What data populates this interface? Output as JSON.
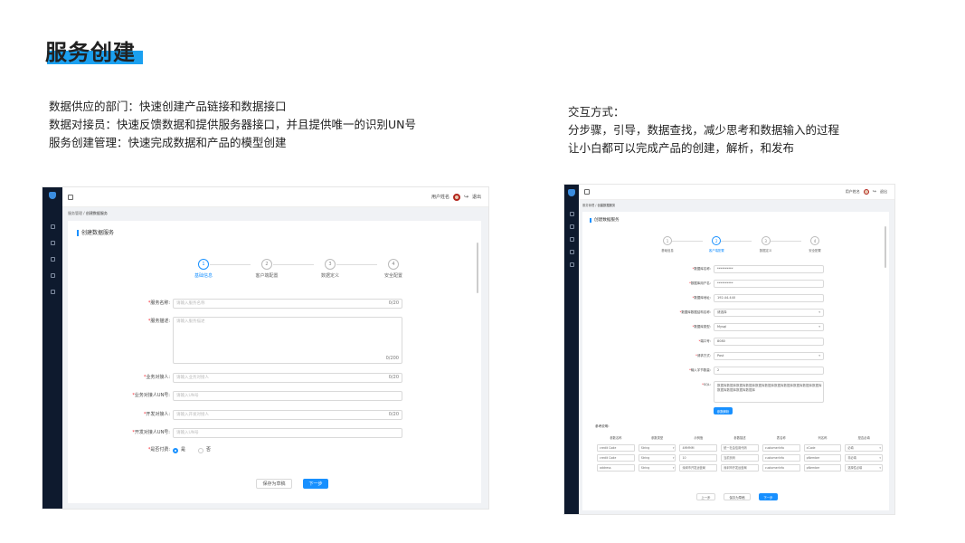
{
  "slide": {
    "title": "服务创建",
    "left_lines": [
      "数据供应的部门：快速创建产品链接和数据接口",
      "数据对接员：快速反馈数据和提供服务器接口，并且提供唯一的识别UN号",
      "服务创建管理：快速完成数据和产品的模型创建"
    ],
    "right_lines": [
      "交互方式：",
      "分步骤，引导，数据查找，减少思考和数据输入的过程",
      "让小白都可以完成产品的创建，解析，和发布"
    ]
  },
  "screen1": {
    "header": {
      "user_name": "用户姓名",
      "logout": "退出"
    },
    "breadcrumb": {
      "parent": "服务管理",
      "sep": "/",
      "current": "创建数据服务"
    },
    "card_title": "创建数据服务",
    "steps": [
      {
        "num": "1",
        "label": "基础信息"
      },
      {
        "num": "2",
        "label": "客户端配置"
      },
      {
        "num": "3",
        "label": "数据定义"
      },
      {
        "num": "4",
        "label": "安全配置"
      }
    ],
    "fields": [
      {
        "label": "服务名称:",
        "placeholder": "请输入服务名称",
        "count": "0/20"
      },
      {
        "label": "服务描述:",
        "placeholder": "请输入服务描述",
        "count": "0/200"
      },
      {
        "label": "业务对接人:",
        "placeholder": "请输入业务对接人",
        "count": "0/20"
      },
      {
        "label": "业务对接人UN号:",
        "placeholder": "请输入UN号"
      },
      {
        "label": "开发对接人:",
        "placeholder": "请输入开发对接人",
        "count": "0/20"
      },
      {
        "label": "开发对接人UN号:",
        "placeholder": "请输入UN号"
      }
    ],
    "paid": {
      "label": "是否付费:",
      "yes": "是",
      "no": "否"
    },
    "buttons": {
      "save_draft": "保存为草稿",
      "next": "下一步"
    }
  },
  "screen2": {
    "header": {
      "user_name": "用户姓名",
      "logout": "退出"
    },
    "breadcrumb": {
      "parent": "服务管理",
      "sep": "/",
      "current": "创建数据服务"
    },
    "card_title": "创建数据服务",
    "steps": [
      {
        "num": "1",
        "label": "基础信息"
      },
      {
        "num": "2",
        "label": "客户端配置"
      },
      {
        "num": "3",
        "label": "数据定义"
      },
      {
        "num": "4",
        "label": "安全配置"
      }
    ],
    "fields": [
      {
        "label": "数据库名称:",
        "value": "**********"
      },
      {
        "label": "数据库用户名:",
        "value": "**********"
      },
      {
        "label": "数据库地址:",
        "value": "192.44.440"
      },
      {
        "label": "数据库数据结构名称:",
        "value": "请选择"
      },
      {
        "label": "数据库类型:",
        "value": "Mysql"
      },
      {
        "label": "端口号:",
        "value": "8080"
      },
      {
        "label": "请求方式:",
        "value": "Post"
      },
      {
        "label": "输入字节数量:",
        "value": "2"
      },
      {
        "label": "SQL:",
        "value": "数据库数据库数据库数据库数据库数据库数据库数据库数据库数据库数据库数据库数据库数据库数据库"
      }
    ],
    "test_button": "参数解析",
    "reference": {
      "title": "参考说明:",
      "headers": [
        "参数名称",
        "参数类型",
        "示例值",
        "参数描述",
        "表名称",
        "列名称",
        "是否必填"
      ],
      "rows": [
        [
          "credit Code",
          "String",
          "4MMMM",
          "统一社会信用代码",
          "customerInfo",
          "cCode",
          "必填"
        ],
        [
          "credit Code",
          "String",
          "10",
          "当前页码",
          "customerInfo",
          "pNember",
          "非必填"
        ],
        [
          "address",
          "String",
          "深圳市开发运营局",
          "深圳市开发运营局",
          "customerInfo",
          "pNember",
          "选择性必填"
        ]
      ]
    },
    "buttons": {
      "prev": "上一步",
      "save_draft": "保存为草稿",
      "next": "下一步"
    }
  },
  "colors": {
    "accent": "#1890ff",
    "title_highlight": "#1aa0f0",
    "sidebar": "#0e1a2e"
  }
}
